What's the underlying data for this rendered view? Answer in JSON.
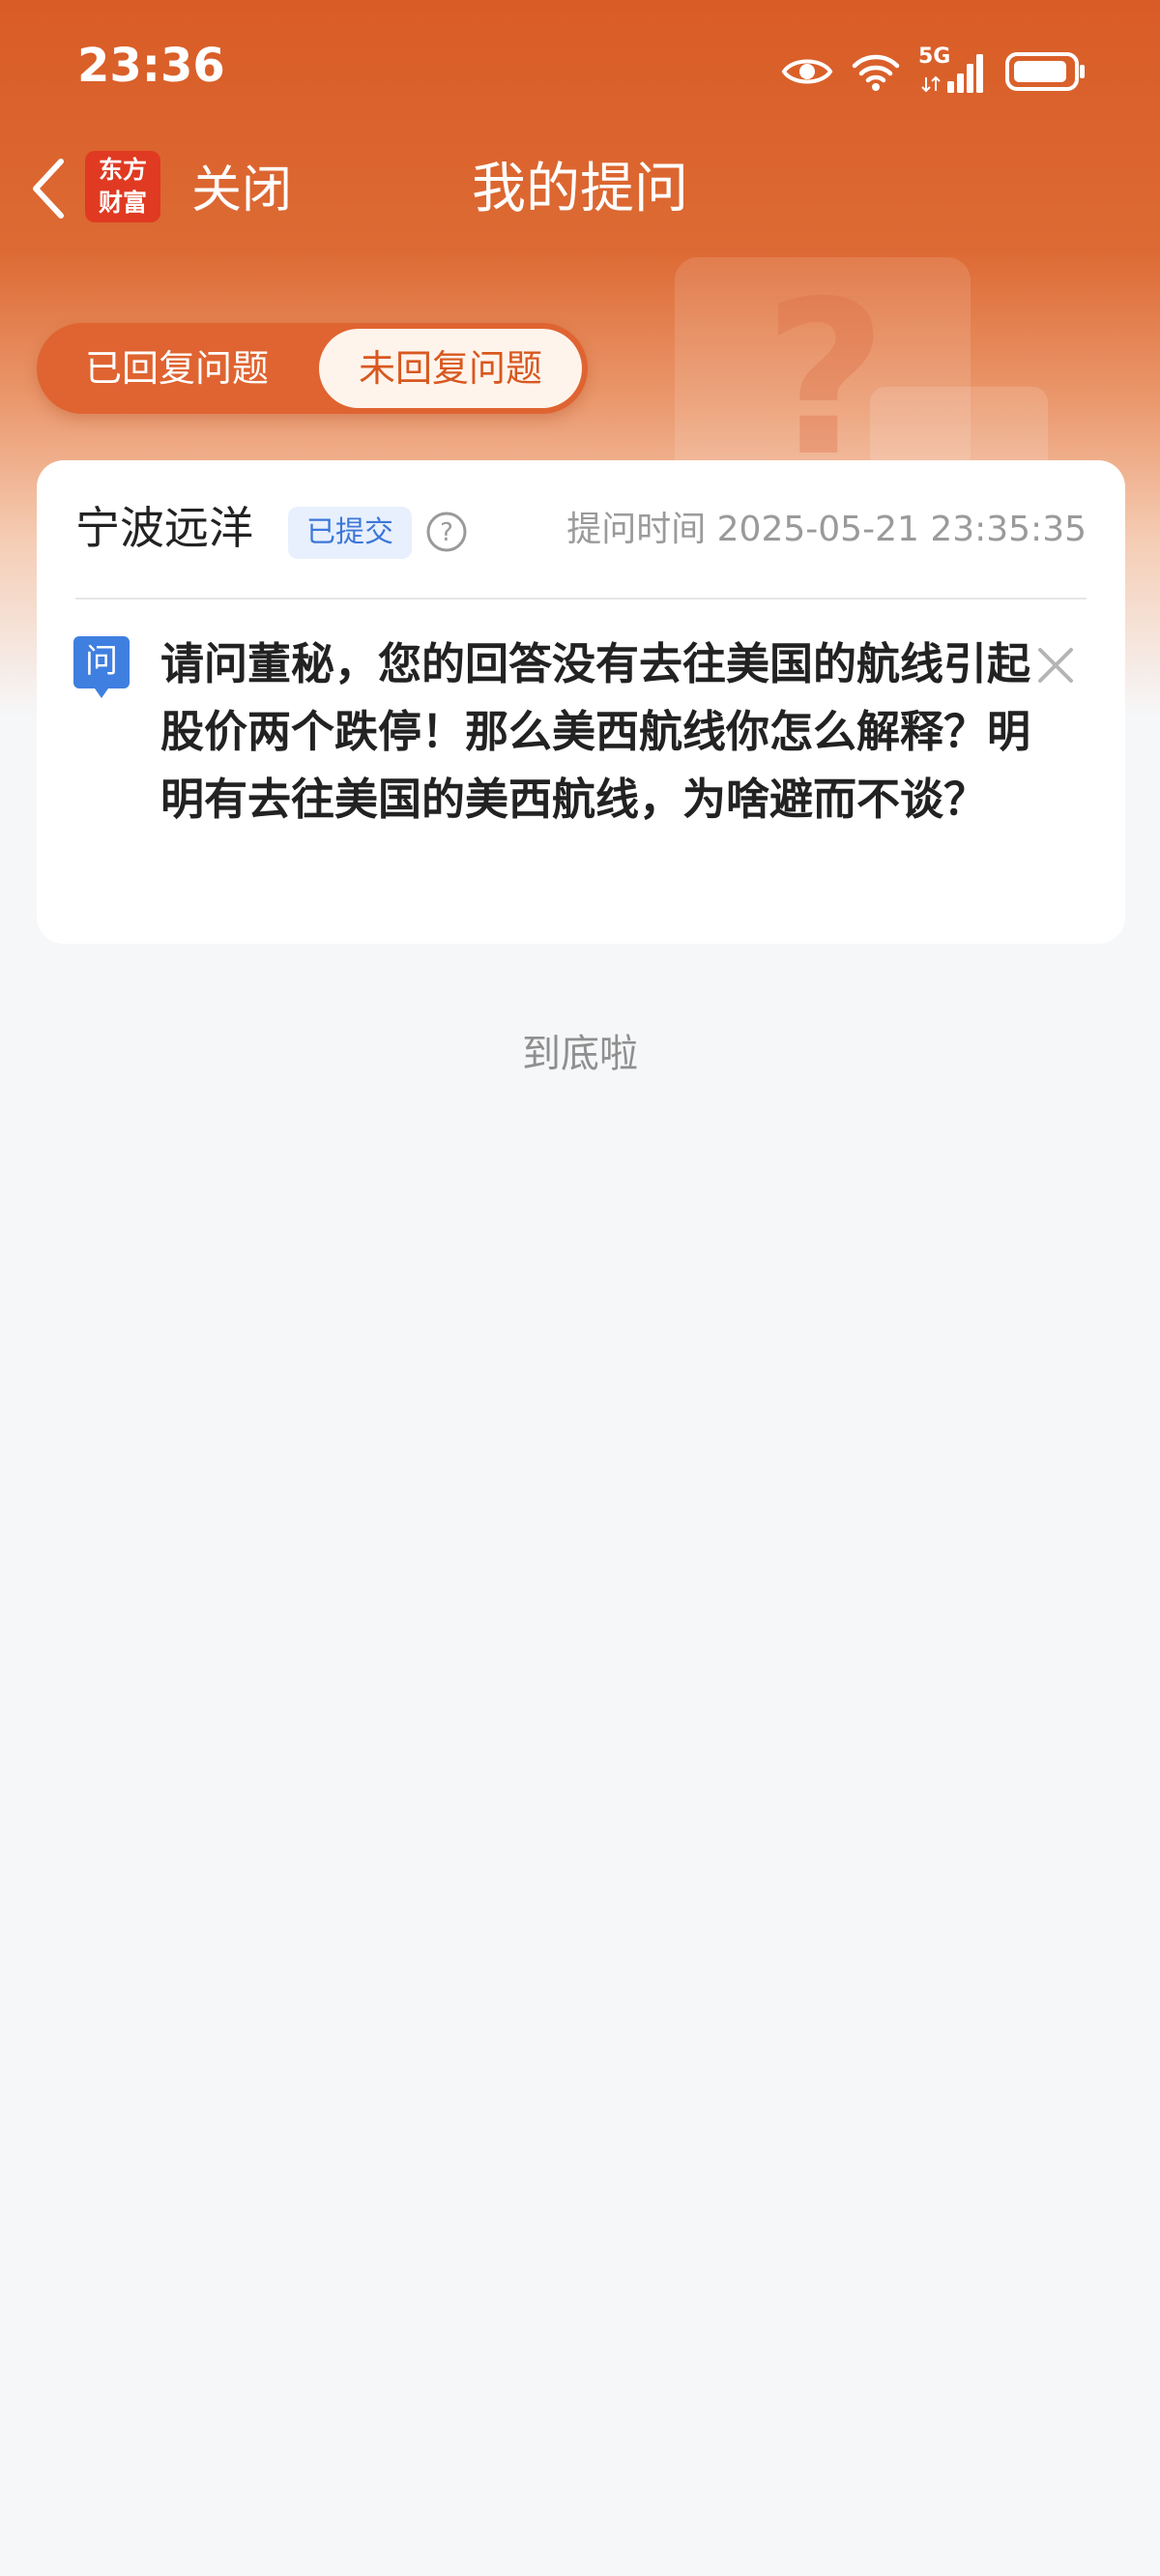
{
  "status_bar": {
    "time": "23:36",
    "network": "5G",
    "icons": [
      "eye-icon",
      "wifi-icon",
      "signal-icon",
      "battery-icon"
    ]
  },
  "nav": {
    "back_icon": "chevron-left-icon",
    "logo_line1": "东方",
    "logo_line2": "财富",
    "close_label": "关闭",
    "title": "我的提问"
  },
  "tabs": [
    {
      "label": "已回复问题",
      "active": false
    },
    {
      "label": "未回复问题",
      "active": true
    }
  ],
  "question_card": {
    "company": "宁波远洋",
    "status_badge": "已提交",
    "help_icon": "question-circle-icon",
    "ask_time_label": "提问时间",
    "ask_time": "2025-05-21 23:35:35",
    "question_marker": "问",
    "question_text": "请问董秘，您的回答没有去往美国的航线引起股价两个跌停！那么美西航线你怎么解释？明明有去往美国的美西航线，为啥避而不谈？",
    "close_icon": "close-icon"
  },
  "footer": {
    "end_text": "到底啦"
  },
  "colors": {
    "brand_orange": "#d95c26",
    "badge_blue": "#3d77d9",
    "background": "#f6f7f9"
  }
}
